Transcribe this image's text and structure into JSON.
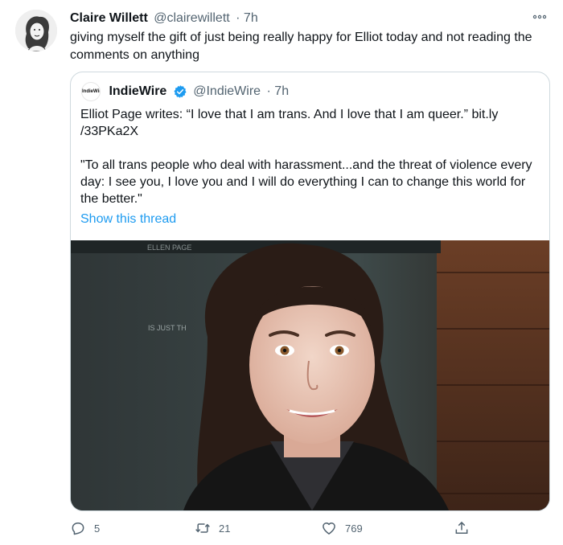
{
  "author": {
    "name": "Claire Willett",
    "handle": "@clairewillett",
    "time": "· 7h",
    "avatar_icon": "avatar-illustration"
  },
  "tweet_text": "giving myself the gift of just being really happy for Elliot today and not reading the comments on anything",
  "quoted": {
    "logo_text": "IndieWire",
    "name": "IndieWire",
    "handle": "@IndieWire",
    "time": "· 7h",
    "text_1": "Elliot Page writes: “I love that I am trans. And I love that I am queer.” bit.ly /33PKa2X",
    "text_2": "\"To all trans people who deal with harassment...and the threat of violence every day: I see you, I love you and I will do everything I can to change this world for the better.\"",
    "show_thread": "Show this thread",
    "photo_backdrop_text_1": "ELLEN PAGE",
    "photo_backdrop_text_2": "IS JUST TH"
  },
  "actions": {
    "reply_count": "5",
    "retweet_count": "21",
    "like_count": "769"
  },
  "colors": {
    "link": "#1d9bf0",
    "secondary_text": "#536471",
    "border": "#cfd9de"
  }
}
